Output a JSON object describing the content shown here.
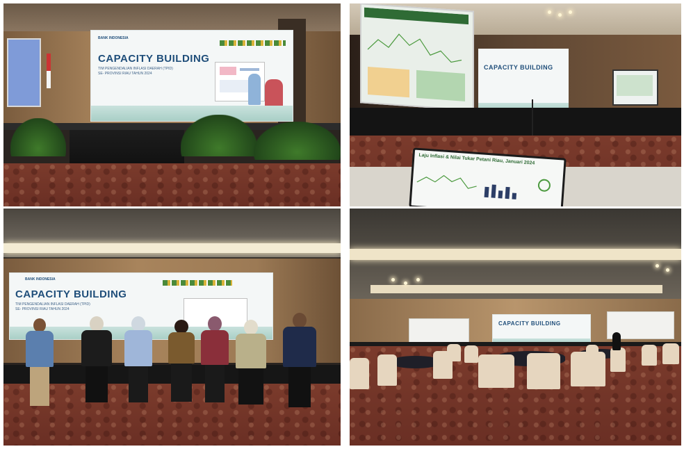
{
  "banner": {
    "org": "BANK INDONESIA",
    "title": "CAPACITY BUILDING",
    "subtitle_line1": "TIM PENGENDALIAN INFLASI DAERAH (TPID)",
    "subtitle_line2": "SE- PROVINSI RIAU TAHUN 2024"
  },
  "slide": {
    "title": "Laju Inflasi & Nilai Tukar Petani Riau, Januari 2024"
  }
}
